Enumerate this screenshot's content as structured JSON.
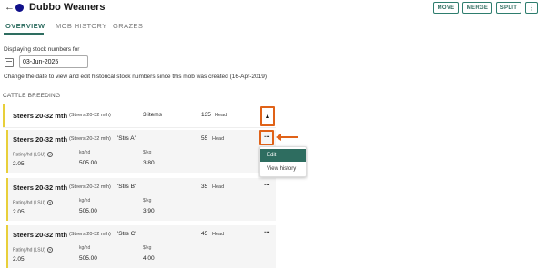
{
  "header": {
    "back_icon": "←",
    "title": "Dubbo Weaners",
    "mob_color": "#10108a",
    "buttons": {
      "move": "MOVE",
      "merge": "MERGE",
      "split": "SPLIT",
      "more": "⋮"
    }
  },
  "tabs": [
    {
      "label": "OVERVIEW",
      "active": true
    },
    {
      "label": "MOB HISTORY",
      "active": false
    },
    {
      "label": "GRAZES",
      "active": false
    }
  ],
  "stock": {
    "displaying_label": "Displaying stock numbers for",
    "date_value": "03-Jun-2025",
    "help_text": "Change the date to view and edit historical stock numbers since this mob was created (16-Apr-2019)"
  },
  "section_title": "CATTLE BREEDING",
  "group": {
    "name": "Steers 20-32 mth",
    "class": "(Steers 20-32 mth)",
    "items": "3 items",
    "head_count": "135",
    "head_label": "Head",
    "toggle_icon": "▲"
  },
  "items": [
    {
      "name": "Steers 20-32 mth",
      "class": "(Steers 20-32 mth)",
      "tag": "'Strs A'",
      "head_count": "55",
      "head_label": "Head",
      "rating_label": "Rating/hd (LSU)",
      "rating": "2.05",
      "kghd_label": "kg/hd",
      "kghd": "505.00",
      "skg_label": "$/kg",
      "skg": "3.80"
    },
    {
      "name": "Steers 20-32 mth",
      "class": "(Steers 20-32 mth)",
      "tag": "'Strs B'",
      "head_count": "35",
      "head_label": "Head",
      "rating_label": "Rating/hd (LSU)",
      "rating": "2.05",
      "kghd_label": "kg/hd",
      "kghd": "505.00",
      "skg_label": "$/kg",
      "skg": "3.90"
    },
    {
      "name": "Steers 20-32 mth",
      "class": "(Steers 20-32 mth)",
      "tag": "'Strs C'",
      "head_count": "45",
      "head_label": "Head",
      "rating_label": "Rating/hd (LSU)",
      "rating": "2.05",
      "kghd_label": "kg/hd",
      "kghd": "505.00",
      "skg_label": "$/kg",
      "skg": "4.00"
    }
  ],
  "more_icon": "···",
  "help_icon": "?",
  "menu": {
    "edit": "Edit",
    "view_history": "View history"
  },
  "colors": {
    "accent": "#2e6d60",
    "highlight": "#e06218",
    "group_bar": "#e8cf3a"
  }
}
